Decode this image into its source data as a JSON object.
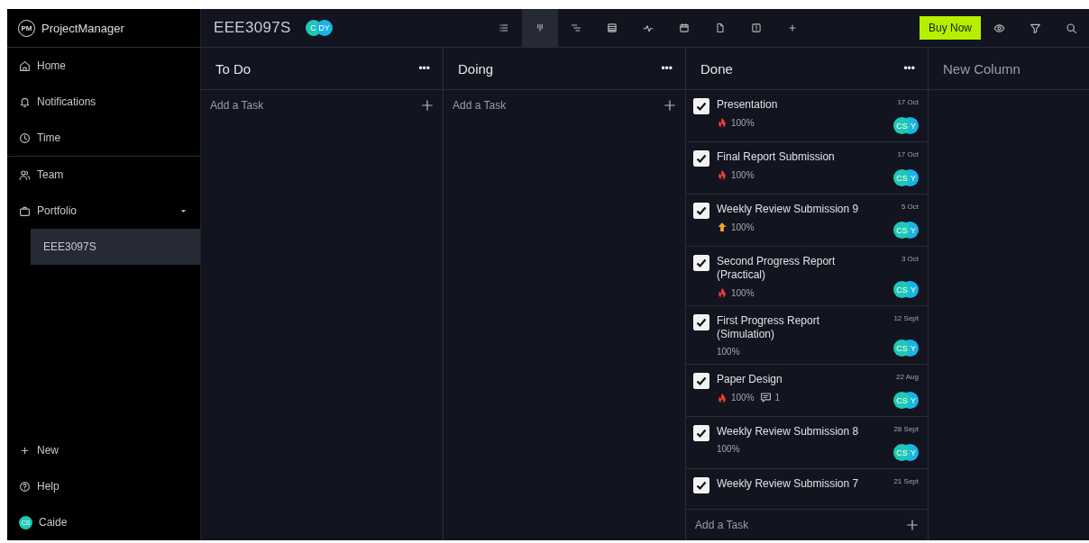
{
  "app": {
    "logo": "PM",
    "name": "ProjectManager"
  },
  "sidebar": {
    "items": [
      {
        "kind": "home",
        "label": "Home"
      },
      {
        "kind": "bell",
        "label": "Notifications"
      },
      {
        "kind": "clock",
        "label": "Time"
      },
      {
        "kind": "team",
        "label": "Team"
      },
      {
        "kind": "briefcase",
        "label": "Portfolio",
        "expanded": true,
        "children": [
          {
            "label": "EEE3097S",
            "selected": true
          }
        ]
      }
    ],
    "bottom": [
      {
        "kind": "plus",
        "label": "New"
      },
      {
        "kind": "help",
        "label": "Help"
      }
    ],
    "user": {
      "initials": "CS",
      "name": "Caide"
    }
  },
  "header": {
    "project": "EEE3097S",
    "avatars": [
      {
        "initials": "C",
        "color": "#1fc7b6"
      },
      {
        "initials": "DY",
        "color": "#1ab3e6"
      }
    ],
    "views": [
      {
        "kind": "list",
        "selected": false
      },
      {
        "kind": "board",
        "selected": true
      },
      {
        "kind": "gantt",
        "selected": false
      },
      {
        "kind": "sheet",
        "selected": false
      },
      {
        "kind": "activity",
        "selected": false
      },
      {
        "kind": "calendar",
        "selected": false
      },
      {
        "kind": "doc",
        "selected": false
      },
      {
        "kind": "alert",
        "selected": false
      },
      {
        "kind": "add",
        "selected": false
      }
    ],
    "buy": "Buy Now"
  },
  "columns": [
    {
      "title": "To Do",
      "menu": "•••",
      "add_task": "Add a Task"
    },
    {
      "title": "Doing",
      "menu": "•••",
      "add_task": "Add a Task"
    },
    {
      "title": "Done",
      "menu": "•••",
      "add_task": "Add a Task",
      "cards": [
        {
          "title": "Presentation",
          "checked": true,
          "priority": {
            "kind": "critical"
          },
          "progress": "100%",
          "date": "17 Oct",
          "avatars": [
            "CS",
            "Y"
          ]
        },
        {
          "title": "Final Report Submission",
          "checked": true,
          "priority": {
            "kind": "critical"
          },
          "progress": "100%",
          "date": "17 Oct",
          "avatars": [
            "CS",
            "Y"
          ]
        },
        {
          "title": "Weekly Review Submission 9",
          "checked": true,
          "priority": {
            "kind": "high"
          },
          "progress": "100%",
          "date": "5 Oct",
          "avatars": [
            "CS",
            "Y"
          ]
        },
        {
          "title": "Second Progress Report (Practical)",
          "checked": true,
          "priority": {
            "kind": "critical"
          },
          "progress": "100%",
          "date": "3 Oct",
          "avatars": [
            "CS",
            "Y"
          ]
        },
        {
          "title": "First Progress Report (Simulation)",
          "checked": true,
          "progress": "100%",
          "date": "12 Sept",
          "avatars": [
            "CS",
            "Y"
          ]
        },
        {
          "title": "Paper Design",
          "checked": true,
          "priority": {
            "kind": "critical"
          },
          "progress": "100%",
          "comments": "1",
          "date": "22 Aug",
          "avatars": [
            "CS",
            "Y"
          ]
        },
        {
          "title": "Weekly Review Submission 8",
          "checked": true,
          "progress": "100%",
          "date": "28 Sept",
          "avatars": [
            "CS",
            "Y"
          ]
        },
        {
          "title": "Weekly Review Submission 7",
          "checked": true,
          "date": "21 Sept"
        }
      ]
    },
    {
      "title": "New Column"
    }
  ]
}
